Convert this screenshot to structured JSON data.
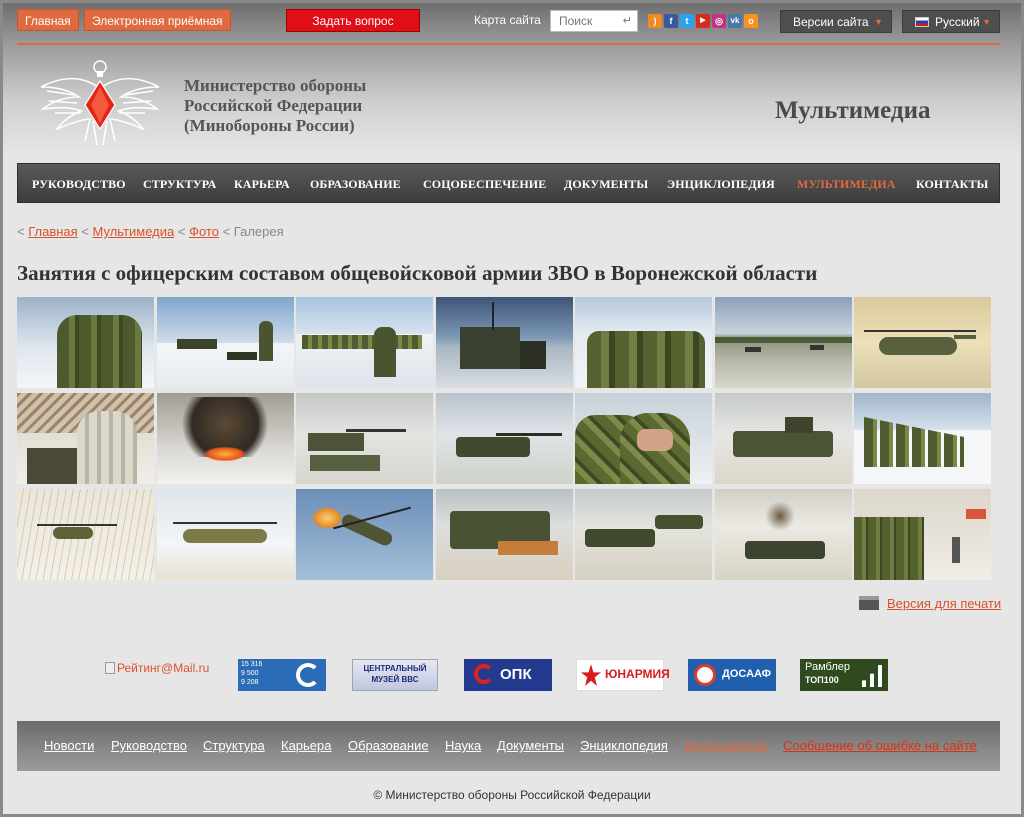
{
  "topbar": {
    "home_label": "Главная",
    "reception_label": "Электронная приёмная",
    "ask_label": "Задать вопрос",
    "sitemap_label": "Карта сайта",
    "search_placeholder": "Поиск",
    "versions_label": "Версии сайта",
    "language_label": "Русский",
    "social_icons": [
      "rss-icon",
      "facebook-icon",
      "twitter-icon",
      "youtube-icon",
      "instagram-icon",
      "vk-icon",
      "odnoklassniki-icon"
    ]
  },
  "header": {
    "ministry_line1": "Министерство обороны",
    "ministry_line2": "Российской Федерации",
    "ministry_line3": "(Минобороны России)",
    "section_title": "Мультимедиа"
  },
  "nav": {
    "items": [
      {
        "label": "РУКОВОДСТВО"
      },
      {
        "label": "СТРУКТУРА"
      },
      {
        "label": "КАРЬЕРА"
      },
      {
        "label": "ОБРАЗОВАНИЕ"
      },
      {
        "label": "СОЦОБЕСПЕЧЕНИЕ"
      },
      {
        "label": "ДОКУМЕНТЫ"
      },
      {
        "label": "ЭНЦИКЛОПЕДИЯ"
      },
      {
        "label": "МУЛЬТИМЕДИА"
      },
      {
        "label": "КОНТАКТЫ"
      }
    ],
    "active": "МУЛЬТИМЕДИА"
  },
  "breadcrumb": {
    "home": "Главная",
    "multimedia": "Мультимедиа",
    "photo": "Фото",
    "current": "Галерея"
  },
  "page_title": "Занятия с офицерским составом общевойсковой армии ЗВО в Воронежской области",
  "print_label": "Версия для печати",
  "partners": {
    "mailru_alt": "Рейтинг@Mail.ru",
    "counter_lines": [
      "15 316",
      "9 500",
      "9 208"
    ],
    "museum_label": "ЦЕНТРАЛЬНЫЙ МУЗЕЙ ВВС",
    "opk_label": "ОПК",
    "yunarmia_label": "ЮНАРМИЯ",
    "dosaaf_label": "ДОСААФ",
    "rambler_label": "Рамблер",
    "rambler_sub": "ТОП100"
  },
  "footer": {
    "links": [
      {
        "label": "Новости"
      },
      {
        "label": "Руководство"
      },
      {
        "label": "Структура"
      },
      {
        "label": "Карьера"
      },
      {
        "label": "Образование"
      },
      {
        "label": "Наука"
      },
      {
        "label": "Документы"
      },
      {
        "label": "Энциклопедия"
      },
      {
        "label": "Мультимедиа"
      },
      {
        "label": "Сообщение об ошибке на сайте"
      }
    ],
    "copyright": "© Министерство обороны Российской Федерации"
  },
  "colors": {
    "accent": "#e06a3f",
    "ask_button": "#e00e16",
    "nav_bg": "#3d3d3d"
  }
}
